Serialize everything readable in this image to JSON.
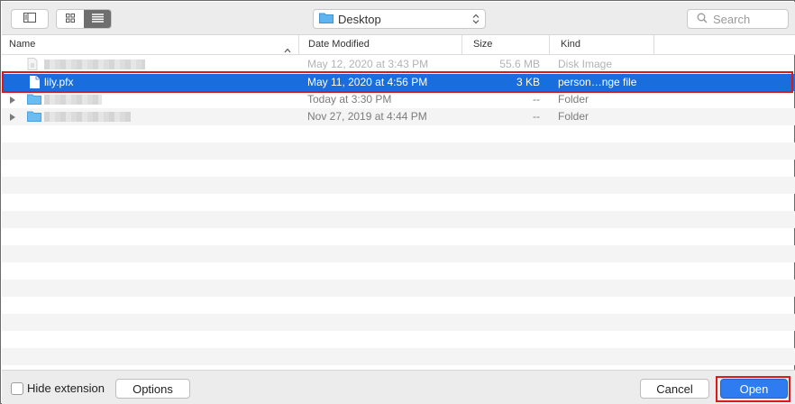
{
  "toolbar": {
    "location": "Desktop",
    "search_placeholder": "Search"
  },
  "columns": {
    "name": "Name",
    "date": "Date Modified",
    "size": "Size",
    "kind": "Kind"
  },
  "rows": [
    {
      "name": "",
      "date": "May 12, 2020 at 3:43 PM",
      "size": "55.6 MB",
      "kind": "Disk Image"
    },
    {
      "name": "lily.pfx",
      "date": "May 11, 2020 at 4:56 PM",
      "size": "3 KB",
      "kind": "person…nge file"
    },
    {
      "name": "",
      "date": "Today at 3:30 PM",
      "size": "--",
      "kind": "Folder"
    },
    {
      "name": "",
      "date": "Nov 27, 2019 at 4:44 PM",
      "size": "--",
      "kind": "Folder"
    }
  ],
  "bottom": {
    "hide_extension": "Hide extension",
    "options": "Options",
    "cancel": "Cancel",
    "open": "Open"
  },
  "colors": {
    "selection": "#1a6ddc",
    "highlight_outline": "#d91b1b",
    "primary_button": "#2e7cf0"
  }
}
